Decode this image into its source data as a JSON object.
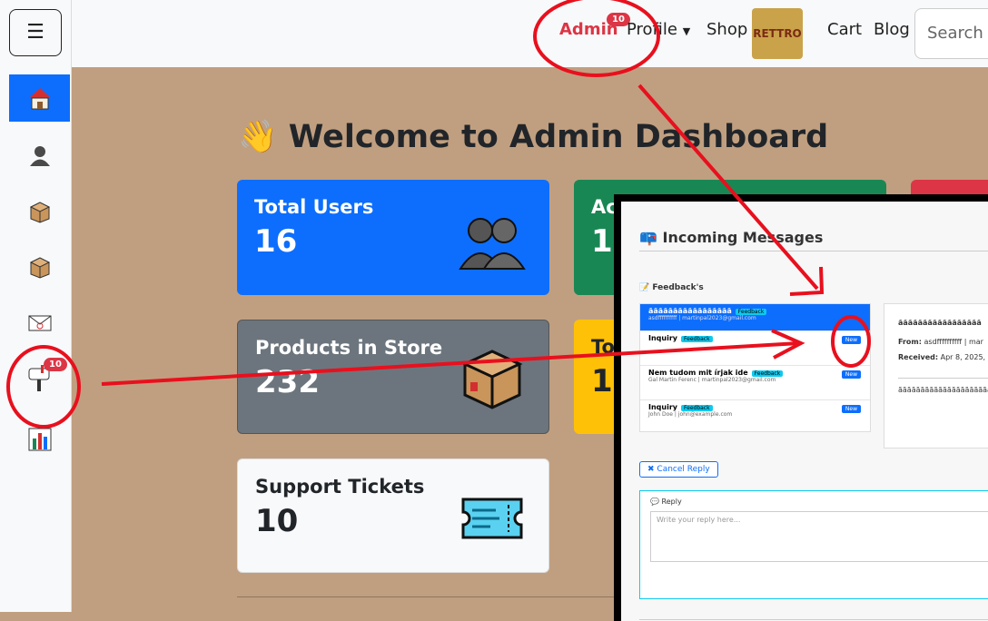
{
  "sidebar": {
    "toggle_icon": "hamburger-icon",
    "items": [
      {
        "icon": "house-icon"
      },
      {
        "icon": "user-icon"
      },
      {
        "icon": "package-icon"
      },
      {
        "icon": "package-icon"
      },
      {
        "icon": "envelope-icon"
      },
      {
        "icon": "mailbox-icon",
        "badge": "10"
      },
      {
        "icon": "bar-chart-icon"
      }
    ]
  },
  "nav": {
    "admin": "Admin",
    "admin_badge": "10",
    "profile": "Profile",
    "shop": "Shop",
    "logo_text": "RETTRO",
    "cart": "Cart",
    "blog": "Blog",
    "search_placeholder": "Search"
  },
  "main": {
    "welcome_emoji": "👋",
    "welcome": "Welcome to Admin Dashboard",
    "cards": [
      {
        "title": "Total Users",
        "value": "16",
        "color": "#0d6efd"
      },
      {
        "title": "Ac",
        "value": "1",
        "color": "#198754"
      },
      {
        "title": "Products in Store",
        "value": "232",
        "color": "#6c757d"
      },
      {
        "title": "To",
        "value": "1",
        "color": "#ffc107"
      },
      {
        "title": "Support Tickets",
        "value": "10",
        "color": "#f8f9fa"
      }
    ]
  },
  "overlay": {
    "title": "Incoming Messages",
    "feedbacks_label": "Feedback's",
    "messages": [
      {
        "title": "ããããããããããããããããã",
        "tag": "Feedback",
        "from": "asdffffffffff | martinpal2023@gmail.com"
      },
      {
        "title": "Inquiry",
        "tag": "Feedback",
        "from": "",
        "badge": "New"
      },
      {
        "title": "Nem tudom mit írjak ide",
        "tag": "Feedback",
        "from": "Gal Martin Ferenc | martinpal2023@gmail.com",
        "badge": "New"
      },
      {
        "title": "Inquiry",
        "tag": "Feedback",
        "from": "John Doe | john@example.com",
        "badge": "New"
      }
    ],
    "detail": {
      "heading": "ããããããããããããããããã",
      "from_label": "From:",
      "from_value": "asdffffffffff | mar",
      "received_label": "Received:",
      "received_value": "Apr 8, 2025,",
      "body": "ããããããããããããããããããããããã"
    },
    "cancel_reply": "Cancel Reply",
    "reply_label": "Reply",
    "reply_placeholder": "Write your reply here..."
  },
  "colors": {
    "annotation": "#e8101e",
    "accent": "#0d6efd",
    "background": "#c09f80"
  }
}
